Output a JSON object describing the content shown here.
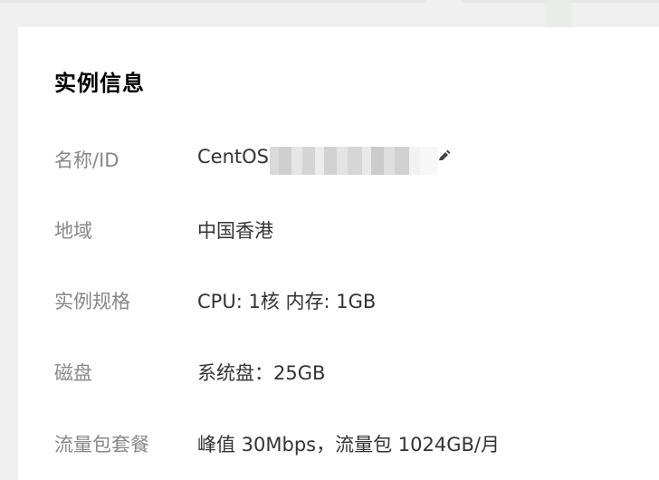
{
  "card": {
    "title": "实例信息"
  },
  "rows": [
    {
      "label": "名称/ID",
      "value": "CentOS"
    },
    {
      "label": "地域",
      "value": "中国香港"
    },
    {
      "label": "实例规格",
      "value": "CPU: 1核 内存: 1GB"
    },
    {
      "label": "磁盘",
      "value": "系统盘：25GB"
    },
    {
      "label": "流量包套餐",
      "value": "峰值 30Mbps，流量包 1024GB/月"
    }
  ],
  "icons": {
    "edit": "pencil-icon"
  }
}
